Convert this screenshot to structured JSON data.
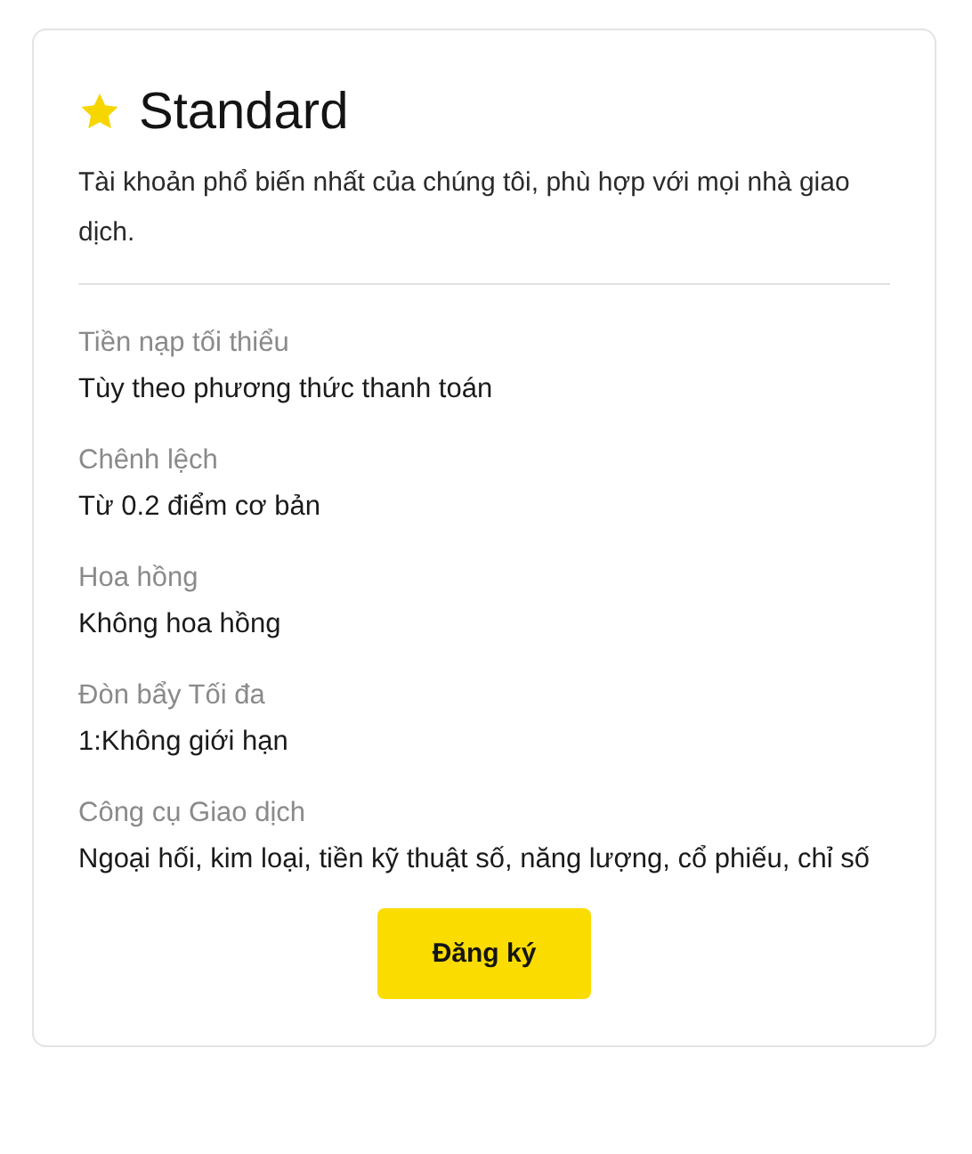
{
  "plan": {
    "title": "Standard",
    "description": "Tài khoản phổ biến nhất của chúng tôi, phù hợp với mọi nhà giao dịch.",
    "details": [
      {
        "label": "Tiền nạp tối thiểu",
        "value": "Tùy theo phương thức thanh toán"
      },
      {
        "label": "Chênh lệch",
        "value": "Từ 0.2 điểm cơ bản"
      },
      {
        "label": "Hoa hồng",
        "value": "Không hoa hồng"
      },
      {
        "label": "Đòn bẩy Tối đa",
        "value": "1:Không giới hạn"
      },
      {
        "label": "Công cụ Giao dịch",
        "value": "Ngoại hối, kim loại, tiền kỹ thuật số, năng lượng, cổ phiếu, chỉ số"
      }
    ],
    "button": "Đăng ký"
  }
}
